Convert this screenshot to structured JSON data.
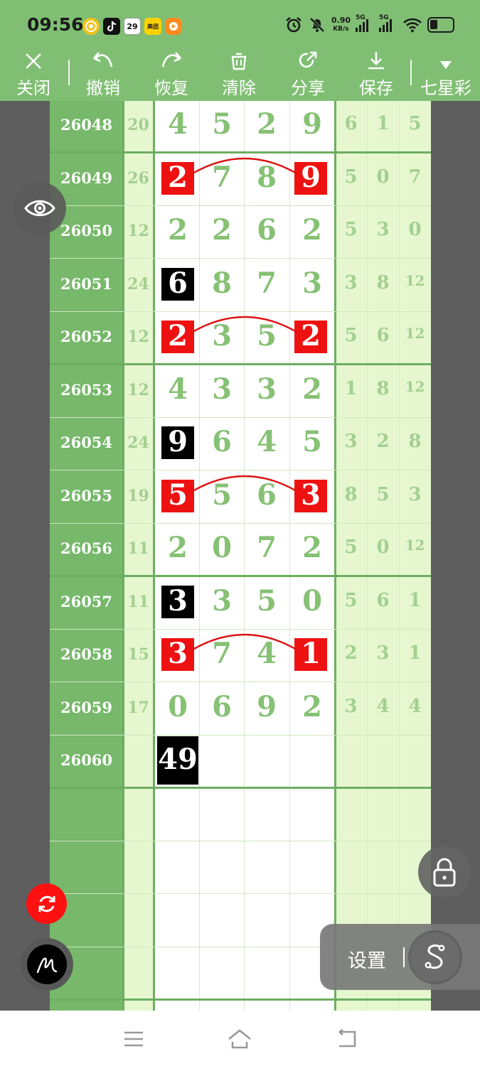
{
  "status_bar": {
    "time": "09:56",
    "apps": [
      "wallet-app-icon",
      "tiktok-icon",
      "calendar-icon",
      "meituan-icon",
      "video-app-icon"
    ],
    "calendar_day": "29",
    "meituan_label": "美团",
    "net_speed_value": "0.90",
    "net_speed_unit": "KB/s",
    "sim1": "5G",
    "sim2": "5G"
  },
  "toolbar": {
    "close": "关闭",
    "undo": "撤销",
    "redo": "恢复",
    "clear": "清除",
    "share": "分享",
    "save": "保存",
    "lottery": "七星彩"
  },
  "table": {
    "rows": [
      {
        "id": "26048",
        "sum": "20",
        "digits": [
          "4",
          "5",
          "2",
          "9"
        ],
        "right": [
          "6",
          "1",
          "5"
        ],
        "boxes": [
          null,
          null,
          null,
          null
        ],
        "arc": false
      },
      {
        "id": "26049",
        "sum": "26",
        "digits": [
          "2",
          "7",
          "8",
          "9"
        ],
        "right": [
          "5",
          "0",
          "7"
        ],
        "boxes": [
          "red",
          null,
          null,
          "red"
        ],
        "arc": true
      },
      {
        "id": "26050",
        "sum": "12",
        "digits": [
          "2",
          "2",
          "6",
          "2"
        ],
        "right": [
          "5",
          "3",
          "0"
        ],
        "boxes": [
          null,
          null,
          null,
          null
        ],
        "arc": false
      },
      {
        "id": "26051",
        "sum": "24",
        "digits": [
          "6",
          "8",
          "7",
          "3"
        ],
        "right": [
          "3",
          "8",
          "12"
        ],
        "boxes": [
          "black",
          null,
          null,
          null
        ],
        "arc": false
      },
      {
        "id": "26052",
        "sum": "12",
        "digits": [
          "2",
          "3",
          "5",
          "2"
        ],
        "right": [
          "5",
          "6",
          "12"
        ],
        "boxes": [
          "red",
          null,
          null,
          "red"
        ],
        "arc": true
      },
      {
        "id": "26053",
        "sum": "12",
        "digits": [
          "4",
          "3",
          "3",
          "2"
        ],
        "right": [
          "1",
          "8",
          "12"
        ],
        "boxes": [
          null,
          null,
          null,
          null
        ],
        "arc": false
      },
      {
        "id": "26054",
        "sum": "24",
        "digits": [
          "9",
          "6",
          "4",
          "5"
        ],
        "right": [
          "3",
          "2",
          "8"
        ],
        "boxes": [
          "black",
          null,
          null,
          null
        ],
        "arc": false
      },
      {
        "id": "26055",
        "sum": "19",
        "digits": [
          "5",
          "5",
          "6",
          "3"
        ],
        "right": [
          "8",
          "5",
          "3"
        ],
        "boxes": [
          "red",
          null,
          null,
          "red"
        ],
        "arc": true
      },
      {
        "id": "26056",
        "sum": "11",
        "digits": [
          "2",
          "0",
          "7",
          "2"
        ],
        "right": [
          "5",
          "0",
          "12"
        ],
        "boxes": [
          null,
          null,
          null,
          null
        ],
        "arc": false
      },
      {
        "id": "26057",
        "sum": "11",
        "digits": [
          "3",
          "3",
          "5",
          "0"
        ],
        "right": [
          "5",
          "6",
          "1"
        ],
        "boxes": [
          "black",
          null,
          null,
          null
        ],
        "arc": false
      },
      {
        "id": "26058",
        "sum": "15",
        "digits": [
          "3",
          "7",
          "4",
          "1"
        ],
        "right": [
          "2",
          "3",
          "1"
        ],
        "boxes": [
          "red",
          null,
          null,
          "red"
        ],
        "arc": true
      },
      {
        "id": "26059",
        "sum": "17",
        "digits": [
          "0",
          "6",
          "9",
          "2"
        ],
        "right": [
          "3",
          "4",
          "4"
        ],
        "boxes": [
          null,
          null,
          null,
          null
        ],
        "arc": false
      },
      {
        "id": "26060",
        "sum": "",
        "digits": [
          "49",
          "",
          "",
          ""
        ],
        "right": [
          "",
          "",
          ""
        ],
        "boxes": [
          "black",
          null,
          null,
          null
        ],
        "arc": false
      }
    ]
  },
  "floating": {
    "settings_label": "设置"
  },
  "colors": {
    "bar_green": "#80bf73",
    "id_column_green": "#77b86b",
    "light_green": "#e6f7cf",
    "digit_green": "#86c174",
    "mark_red": "#ee1111",
    "mark_black": "#000000"
  }
}
